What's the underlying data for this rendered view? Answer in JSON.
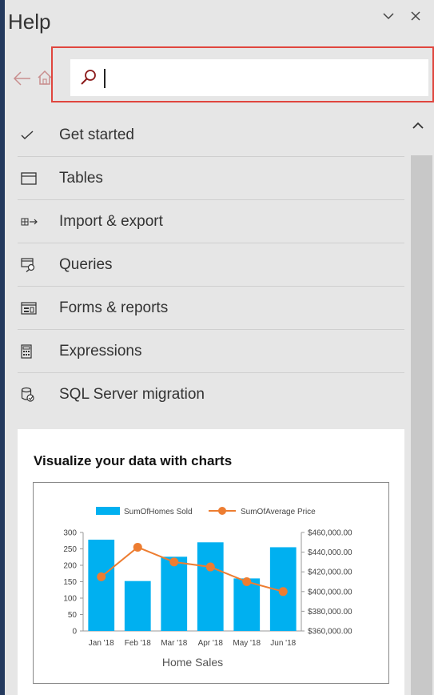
{
  "pane": {
    "title": "Help",
    "collapse_icon": "chevron-down-icon",
    "close_icon": "close-icon"
  },
  "search": {
    "value": "",
    "placeholder": ""
  },
  "topics": [
    {
      "label": "Get started",
      "icon": "check-icon"
    },
    {
      "label": "Tables",
      "icon": "table-icon"
    },
    {
      "label": "Import & export",
      "icon": "import-export-icon"
    },
    {
      "label": "Queries",
      "icon": "query-icon"
    },
    {
      "label": "Forms & reports",
      "icon": "form-icon"
    },
    {
      "label": "Expressions",
      "icon": "calculator-icon"
    },
    {
      "label": "SQL Server migration",
      "icon": "database-migration-icon"
    }
  ],
  "card": {
    "title": "Visualize your data with charts"
  },
  "colors": {
    "bar": "#00b0f0",
    "line": "#ed7d31",
    "highlight": "#e0463e"
  },
  "chart_data": {
    "type": "bar",
    "title": "Home Sales",
    "categories": [
      "Jan '18",
      "Feb '18",
      "Mar '18",
      "Apr '18",
      "May '18",
      "Jun '18"
    ],
    "series": [
      {
        "name": "SumOfHomes Sold",
        "type": "bar",
        "axis": "left",
        "values": [
          278,
          152,
          226,
          270,
          160,
          255
        ]
      },
      {
        "name": "SumOfAverage Price",
        "type": "line",
        "axis": "right",
        "values": [
          415000,
          445000,
          430000,
          425000,
          410000,
          400000
        ]
      }
    ],
    "y_left": {
      "min": 0,
      "max": 300,
      "ticks": [
        "0",
        "50",
        "100",
        "150",
        "200",
        "250",
        "300"
      ]
    },
    "y_right": {
      "min": 360000,
      "max": 460000,
      "ticks": [
        "$360,000.00",
        "$380,000.00",
        "$400,000.00",
        "$420,000.00",
        "$440,000.00",
        "$460,000.00"
      ]
    },
    "legend": "top"
  }
}
